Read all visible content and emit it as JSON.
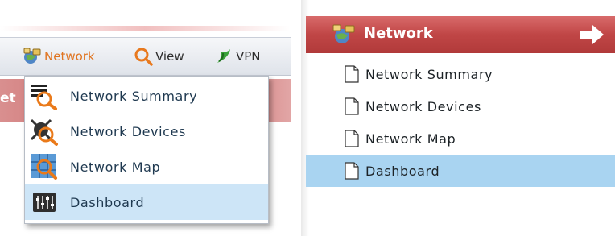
{
  "left_toolbar": {
    "items": [
      {
        "label": "Network",
        "icon": "network-globe-icon"
      },
      {
        "label": "View",
        "icon": "magnifier-icon"
      },
      {
        "label": "VPN",
        "icon": "vpn-swirl-icon"
      }
    ],
    "behind_text": "et"
  },
  "dropdown": {
    "items": [
      {
        "label": "Network Summary",
        "icon": "network-summary-icon",
        "selected": false
      },
      {
        "label": "Network Devices",
        "icon": "network-devices-icon",
        "selected": false
      },
      {
        "label": "Network Map",
        "icon": "network-map-icon",
        "selected": false
      },
      {
        "label": "Dashboard",
        "icon": "dashboard-icon",
        "selected": true
      }
    ]
  },
  "right_panel": {
    "header": {
      "title": "Network",
      "icon": "network-globe-icon",
      "arrow": "right-arrow-icon"
    },
    "items": [
      {
        "label": "Network Summary",
        "icon": "document-icon",
        "selected": false
      },
      {
        "label": "Network Devices",
        "icon": "document-icon",
        "selected": false
      },
      {
        "label": "Network Map",
        "icon": "document-icon",
        "selected": false
      },
      {
        "label": "Dashboard",
        "icon": "document-icon",
        "selected": true
      }
    ]
  },
  "colors": {
    "header_red": "#c04646",
    "selected_dropdown": "#cde5f7",
    "selected_tree": "#a9d4f1",
    "network_orange": "#e07420"
  }
}
